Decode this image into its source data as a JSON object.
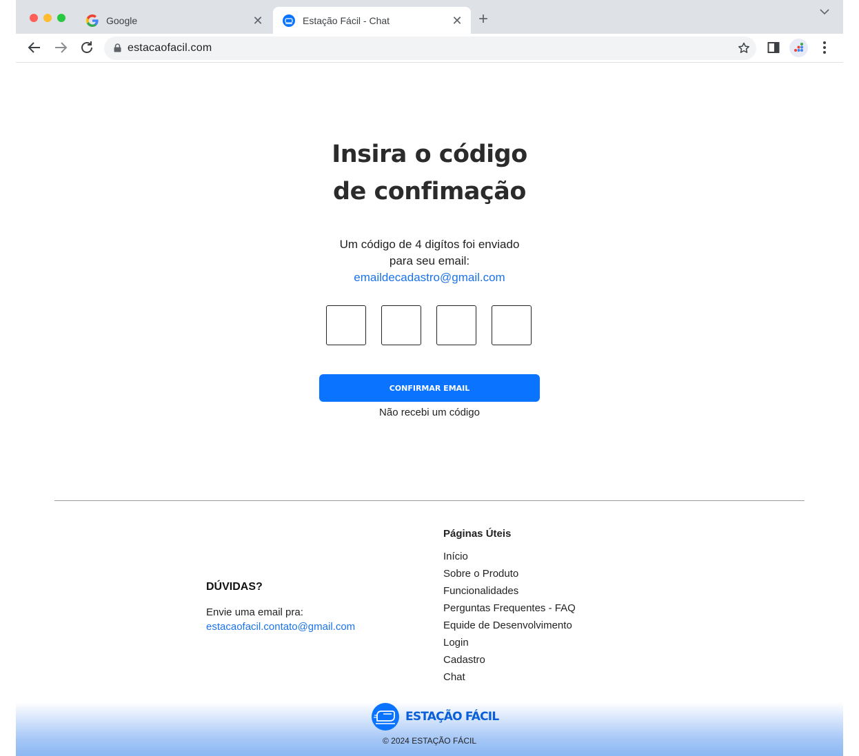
{
  "browser": {
    "tabs": [
      {
        "title": "Google",
        "favicon": "google-favicon-icon",
        "active": false
      },
      {
        "title": "Estação Fácil - Chat",
        "favicon": "estacao-facil-favicon-icon",
        "active": true
      }
    ],
    "url": "estacaofacil.com",
    "colors": {
      "tabstrip": "#dee1e6",
      "omnibox": "#f1f3f4"
    }
  },
  "page": {
    "heading_line1": "Insira o código",
    "heading_line2": "de confimação",
    "subtitle_line1": "Um código de 4 digítos foi enviado",
    "subtitle_line2": "para seu email:",
    "email": "emaildecadastro@gmail.com",
    "code_digits": [
      "",
      "",
      "",
      ""
    ],
    "confirm_button": "CONFIRMAR EMAIL",
    "resend_link": "Não recebi um código"
  },
  "footer": {
    "duvidas_title": "DÚVIDAS?",
    "duvidas_text": "Envie uma email pra:",
    "contact_email": "estacaofacil.contato@gmail.com",
    "pages_title": "Páginas Úteis",
    "pages": [
      "Início",
      "Sobre o Produto",
      "Funcionalidades",
      "Perguntas Frequentes - FAQ",
      "Equide de Desenvolvimento",
      "Login",
      "Cadastro",
      "Chat"
    ],
    "brand": "ESTAÇÃO FÁCIL",
    "copyright": "© 2024 ESTAÇÃO FÁCIL",
    "colors": {
      "brand_blue": "#0a73ff",
      "link_blue": "#1a73e8"
    }
  }
}
